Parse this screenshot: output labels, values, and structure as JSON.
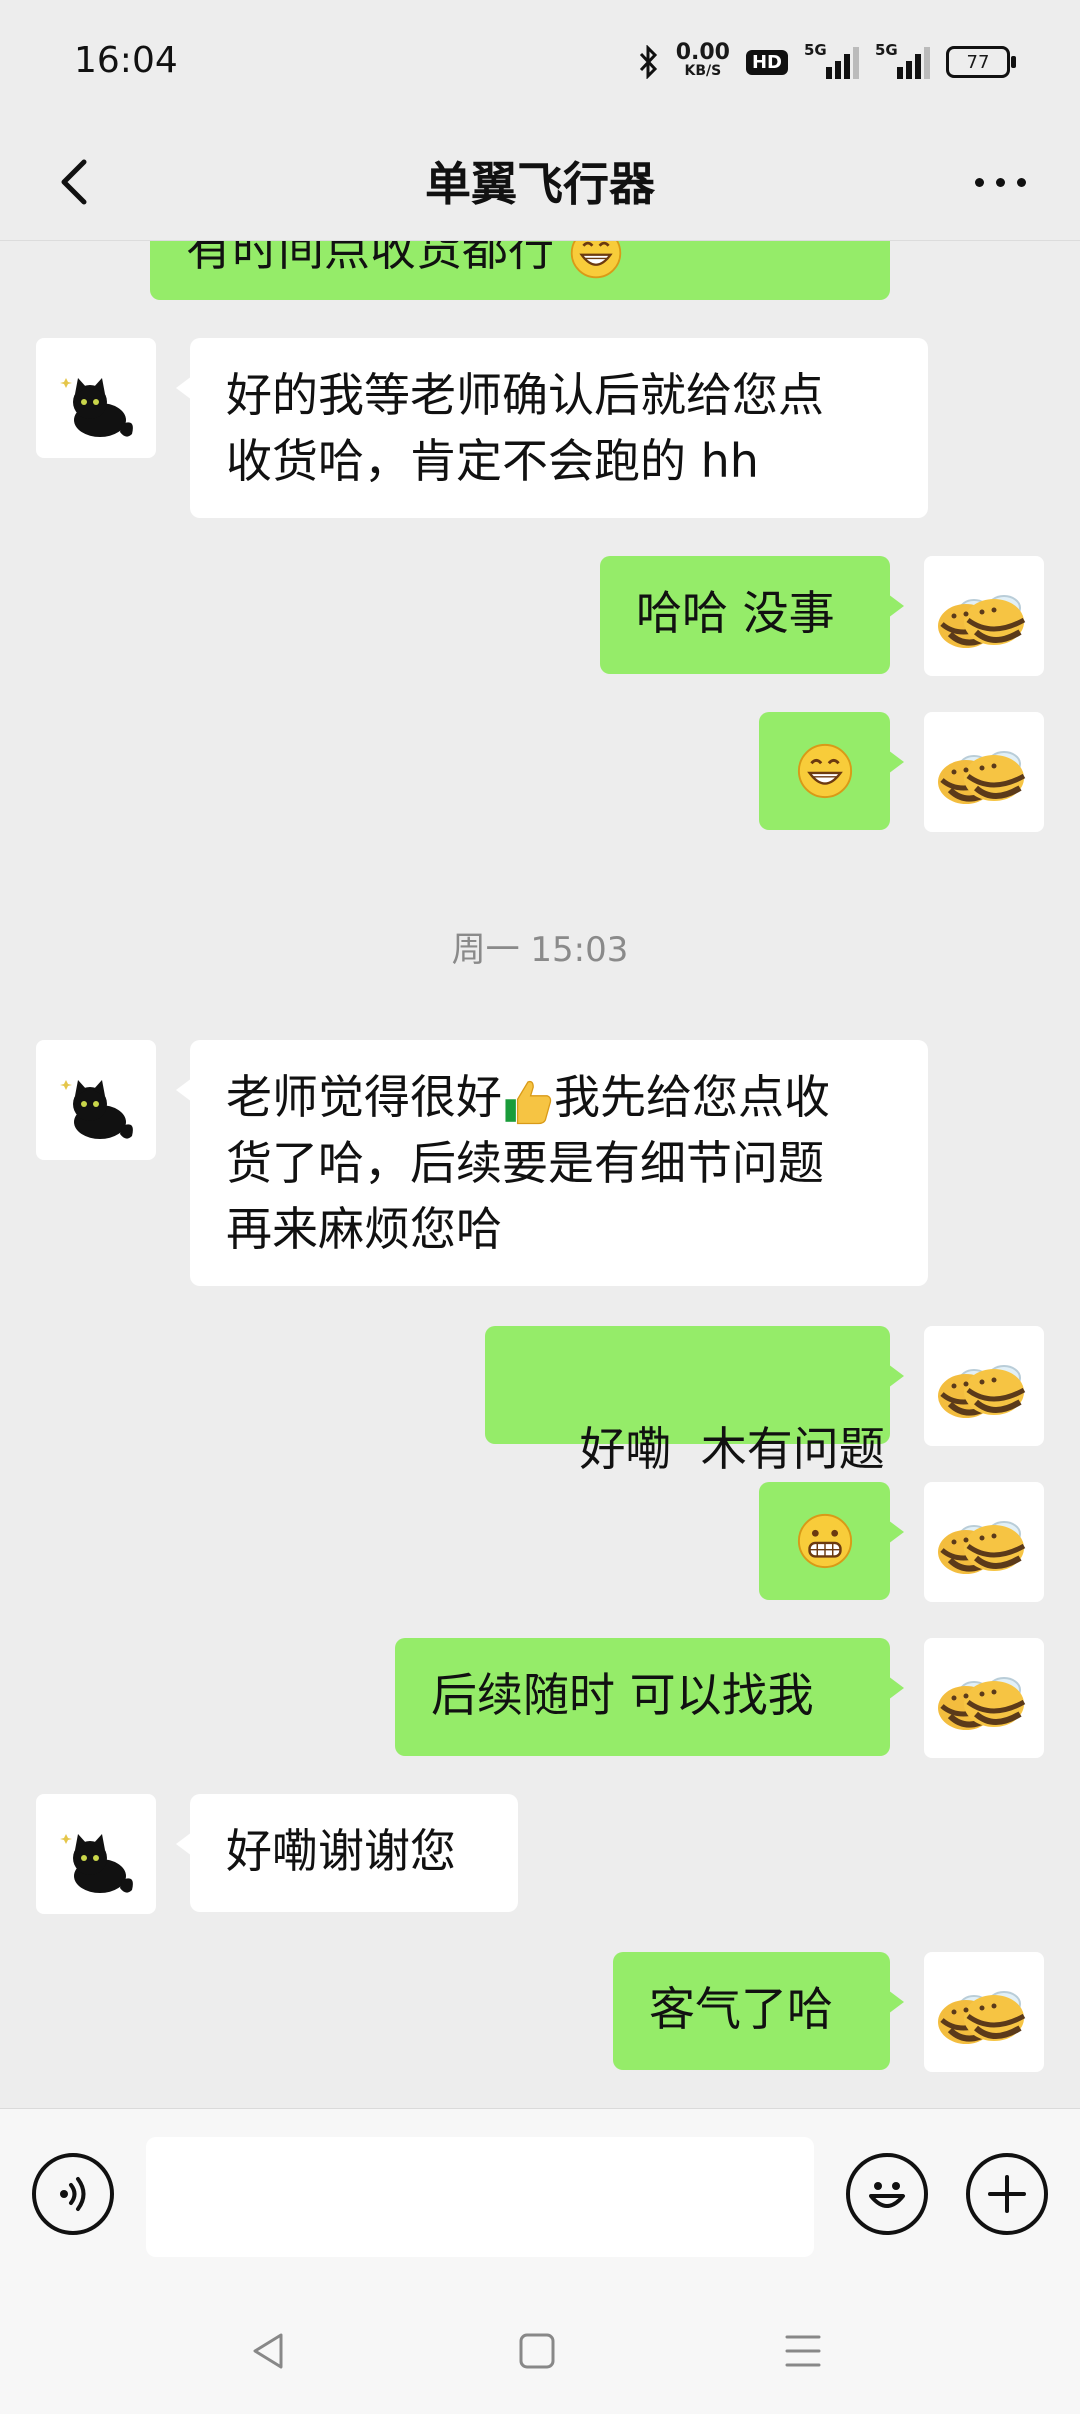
{
  "status_bar": {
    "time": "16:04",
    "net_speed_value": "0.00",
    "net_speed_unit": "KB/S",
    "hd_label": "HD",
    "signal1_label": "5G",
    "signal2_label": "5G",
    "battery": "77"
  },
  "header": {
    "title": "单翼飞行器",
    "back_icon": "chevron-left-icon",
    "more_icon": "more-dots-icon"
  },
  "messages": {
    "m0": "有时间点收货都行",
    "m1_line1": "好的我等老师确认后就给您点",
    "m1_line2": "收货哈，肯定不会跑的 hh",
    "m2": "哈哈 没事",
    "m3_emoji": "grin-icon",
    "timestamp": "周一 15:03",
    "m4_line1a": "老师觉得很好",
    "m4_line1b": "我先给您点收",
    "m4_line2": "货了哈，后续要是有细节问题",
    "m4_line3": "再来麻烦您哈",
    "m5": "好嘞  木有问题",
    "m6_emoji": "grin-teeth-icon",
    "m7": "后续随时 可以找我",
    "m8": "好嘞谢谢您",
    "m9": "客气了哈"
  },
  "input_bar": {
    "voice_icon": "voice-icon",
    "input_value": "",
    "emoji_icon": "emoji-icon",
    "plus_icon": "plus-icon"
  },
  "nav_bar": {
    "back": "nav-back-icon",
    "home": "nav-home-icon",
    "menu": "nav-menu-icon"
  },
  "colors": {
    "background": "#ededed",
    "outgoing_bubble": "#95ec69",
    "incoming_bubble": "#ffffff",
    "timestamp_text": "#8a8a8a"
  }
}
